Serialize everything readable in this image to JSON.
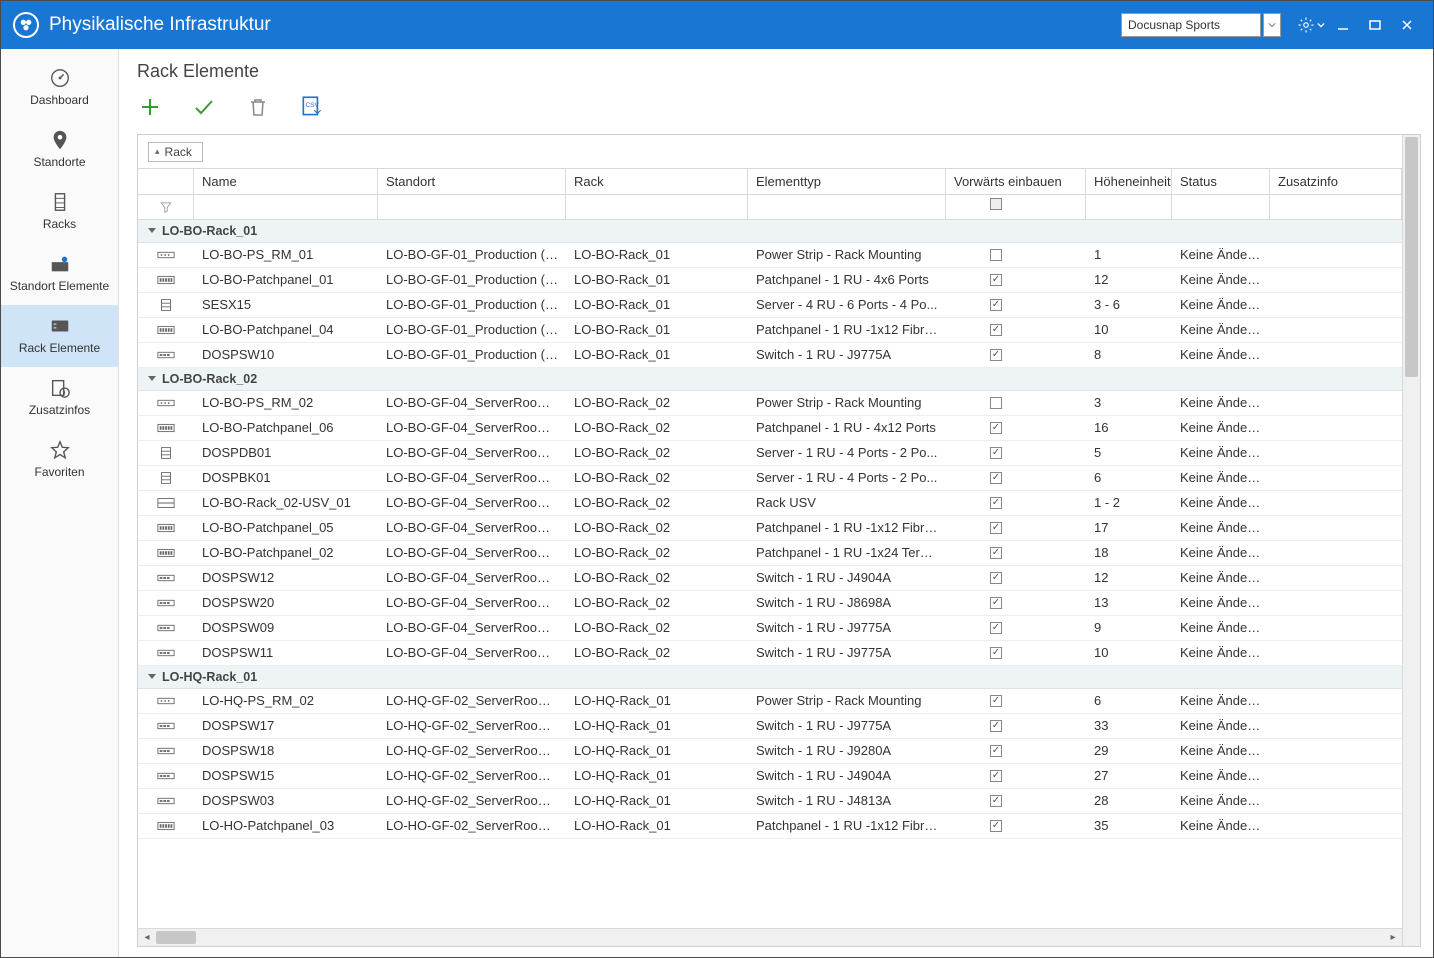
{
  "titlebar": {
    "title": "Physikalische Infrastruktur",
    "tenant": "Docusnap Sports"
  },
  "sidebar": {
    "items": [
      {
        "label": "Dashboard",
        "icon": "gauge"
      },
      {
        "label": "Standorte",
        "icon": "pin"
      },
      {
        "label": "Racks",
        "icon": "rack"
      },
      {
        "label": "Standort Elemente",
        "icon": "site-el"
      },
      {
        "label": "Rack Elemente",
        "icon": "rack-el",
        "active": true
      },
      {
        "label": "Zusatzinfos",
        "icon": "info"
      },
      {
        "label": "Favoriten",
        "icon": "star"
      }
    ]
  },
  "page": {
    "title": "Rack Elemente"
  },
  "group_by": "Rack",
  "columns": [
    "",
    "Name",
    "Standort",
    "Rack",
    "Elementtyp",
    "Vorwärts einbauen",
    "Höheneinheit",
    "Status",
    "Zusatzinfo"
  ],
  "filter_hint_c5": "▫",
  "groups": [
    {
      "name": "LO-BO-Rack_01",
      "rows": [
        {
          "icon": "ps",
          "name": "LO-BO-PS_RM_01",
          "standort": "LO-BO-GF-01_Production (Lo...",
          "rack": "LO-BO-Rack_01",
          "typ": "Power Strip - Rack Mounting",
          "fwd": false,
          "he": "1",
          "status": "Keine Änderu..."
        },
        {
          "icon": "pp",
          "name": "LO-BO-Patchpanel_01",
          "standort": "LO-BO-GF-01_Production (Lo...",
          "rack": "LO-BO-Rack_01",
          "typ": "Patchpanel - 1 RU - 4x6 Ports",
          "fwd": true,
          "he": "12",
          "status": "Keine Änderu..."
        },
        {
          "icon": "srv",
          "name": "SESX15",
          "standort": "LO-BO-GF-01_Production (Lo...",
          "rack": "LO-BO-Rack_01",
          "typ": "Server - 4 RU - 6 Ports - 4 Po...",
          "fwd": true,
          "he": "3 - 6",
          "status": "Keine Änderu..."
        },
        {
          "icon": "pp",
          "name": "LO-BO-Patchpanel_04",
          "standort": "LO-BO-GF-01_Production (Lo...",
          "rack": "LO-BO-Rack_01",
          "typ": "Patchpanel - 1 RU -1x12 Fibre...",
          "fwd": true,
          "he": "10",
          "status": "Keine Änderu..."
        },
        {
          "icon": "sw",
          "name": "DOSPSW10",
          "standort": "LO-BO-GF-01_Production (Lo...",
          "rack": "LO-BO-Rack_01",
          "typ": "Switch - 1 RU - J9775A",
          "fwd": true,
          "he": "8",
          "status": "Keine Änderu..."
        }
      ]
    },
    {
      "name": "LO-BO-Rack_02",
      "rows": [
        {
          "icon": "ps",
          "name": "LO-BO-PS_RM_02",
          "standort": "LO-BO-GF-04_ServerRoom (L...",
          "rack": "LO-BO-Rack_02",
          "typ": "Power Strip - Rack Mounting",
          "fwd": false,
          "he": "3",
          "status": "Keine Änderu..."
        },
        {
          "icon": "pp",
          "name": "LO-BO-Patchpanel_06",
          "standort": "LO-BO-GF-04_ServerRoom (L...",
          "rack": "LO-BO-Rack_02",
          "typ": "Patchpanel - 1 RU - 4x12 Ports",
          "fwd": true,
          "he": "16",
          "status": "Keine Änderu..."
        },
        {
          "icon": "srv",
          "name": "DOSPDB01",
          "standort": "LO-BO-GF-04_ServerRoom (L...",
          "rack": "LO-BO-Rack_02",
          "typ": "Server - 1 RU - 4 Ports - 2 Po...",
          "fwd": true,
          "he": "5",
          "status": "Keine Änderu..."
        },
        {
          "icon": "srv",
          "name": "DOSPBK01",
          "standort": "LO-BO-GF-04_ServerRoom (L...",
          "rack": "LO-BO-Rack_02",
          "typ": "Server - 1 RU - 4 Ports - 2 Po...",
          "fwd": true,
          "he": "6",
          "status": "Keine Änderu..."
        },
        {
          "icon": "usv",
          "name": "LO-BO-Rack_02-USV_01",
          "standort": "LO-BO-GF-04_ServerRoom (L...",
          "rack": "LO-BO-Rack_02",
          "typ": "Rack USV",
          "fwd": true,
          "he": "1 - 2",
          "status": "Keine Änderu..."
        },
        {
          "icon": "pp",
          "name": "LO-BO-Patchpanel_05",
          "standort": "LO-BO-GF-04_ServerRoom (L...",
          "rack": "LO-BO-Rack_02",
          "typ": "Patchpanel - 1 RU -1x12 Fibre...",
          "fwd": true,
          "he": "17",
          "status": "Keine Änderu..."
        },
        {
          "icon": "pp",
          "name": "LO-BO-Patchpanel_02",
          "standort": "LO-BO-GF-04_ServerRoom (L...",
          "rack": "LO-BO-Rack_02",
          "typ": "Patchpanel - 1 RU -1x24 Tera-...",
          "fwd": true,
          "he": "18",
          "status": "Keine Änderu..."
        },
        {
          "icon": "sw",
          "name": "DOSPSW12",
          "standort": "LO-BO-GF-04_ServerRoom (L...",
          "rack": "LO-BO-Rack_02",
          "typ": "Switch - 1 RU - J4904A",
          "fwd": true,
          "he": "12",
          "status": "Keine Änderu..."
        },
        {
          "icon": "sw",
          "name": "DOSPSW20",
          "standort": "LO-BO-GF-04_ServerRoom (L...",
          "rack": "LO-BO-Rack_02",
          "typ": "Switch - 1 RU - J8698A",
          "fwd": true,
          "he": "13",
          "status": "Keine Änderu..."
        },
        {
          "icon": "sw",
          "name": "DOSPSW09",
          "standort": "LO-BO-GF-04_ServerRoom (L...",
          "rack": "LO-BO-Rack_02",
          "typ": "Switch - 1 RU - J9775A",
          "fwd": true,
          "he": "9",
          "status": "Keine Änderu..."
        },
        {
          "icon": "sw",
          "name": "DOSPSW11",
          "standort": "LO-BO-GF-04_ServerRoom (L...",
          "rack": "LO-BO-Rack_02",
          "typ": "Switch - 1 RU - J9775A",
          "fwd": true,
          "he": "10",
          "status": "Keine Änderu..."
        }
      ]
    },
    {
      "name": "LO-HQ-Rack_01",
      "rows": [
        {
          "icon": "ps",
          "name": "LO-HQ-PS_RM_02",
          "standort": "LO-HQ-GF-02_ServerRoom (L...",
          "rack": "LO-HQ-Rack_01",
          "typ": "Power Strip - Rack Mounting",
          "fwd": true,
          "he": "6",
          "status": "Keine Änderu..."
        },
        {
          "icon": "sw",
          "name": "DOSPSW17",
          "standort": "LO-HQ-GF-02_ServerRoom (L...",
          "rack": "LO-HQ-Rack_01",
          "typ": "Switch - 1 RU - J9775A",
          "fwd": true,
          "he": "33",
          "status": "Keine Änderu..."
        },
        {
          "icon": "sw",
          "name": "DOSPSW18",
          "standort": "LO-HQ-GF-02_ServerRoom (L...",
          "rack": "LO-HQ-Rack_01",
          "typ": "Switch - 1 RU - J9280A",
          "fwd": true,
          "he": "29",
          "status": "Keine Änderu..."
        },
        {
          "icon": "sw",
          "name": "DOSPSW15",
          "standort": "LO-HQ-GF-02_ServerRoom (L...",
          "rack": "LO-HQ-Rack_01",
          "typ": "Switch - 1 RU - J4904A",
          "fwd": true,
          "he": "27",
          "status": "Keine Änderu..."
        },
        {
          "icon": "sw",
          "name": "DOSPSW03",
          "standort": "LO-HQ-GF-02_ServerRoom (L...",
          "rack": "LO-HQ-Rack_01",
          "typ": "Switch - 1 RU - J4813A",
          "fwd": true,
          "he": "28",
          "status": "Keine Änderu..."
        },
        {
          "icon": "pp",
          "name": "LO-HO-Patchpanel_03",
          "standort": "LO-HO-GF-02_ServerRoom (L...",
          "rack": "LO-HO-Rack_01",
          "typ": "Patchpanel - 1 RU -1x12 Fibre...",
          "fwd": true,
          "he": "35",
          "status": "Keine Änderu..."
        }
      ]
    }
  ]
}
